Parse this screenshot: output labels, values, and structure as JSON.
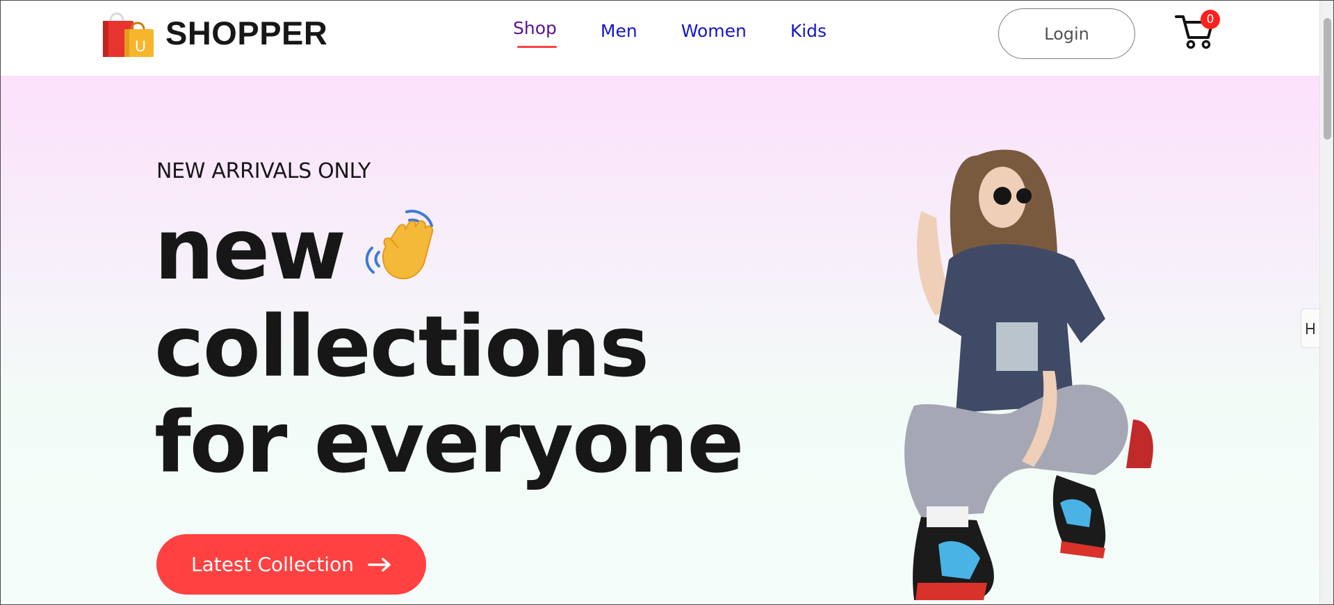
{
  "header": {
    "brand": "SHOPPER",
    "logo_badge": "U",
    "nav": [
      {
        "label": "Shop",
        "active": true
      },
      {
        "label": "Men",
        "active": false
      },
      {
        "label": "Women",
        "active": false
      },
      {
        "label": "Kids",
        "active": false
      }
    ],
    "login_label": "Login",
    "cart_icon": "cart-icon",
    "cart_count": "0"
  },
  "hero": {
    "kicker": "NEW ARRIVALS ONLY",
    "line1": "new",
    "line2": "collections",
    "line3": "for everyone",
    "hand_icon": "waving-hand-icon",
    "cta_label": "Latest Collection",
    "cta_icon": "arrow-right-icon",
    "image": "hero-model-image"
  },
  "colors": {
    "accent": "#ff4141",
    "nav_link": "#1515c8",
    "nav_active": "#5b148a",
    "hero_top": "#fce1fb",
    "hero_bottom": "#f4fdfa"
  }
}
